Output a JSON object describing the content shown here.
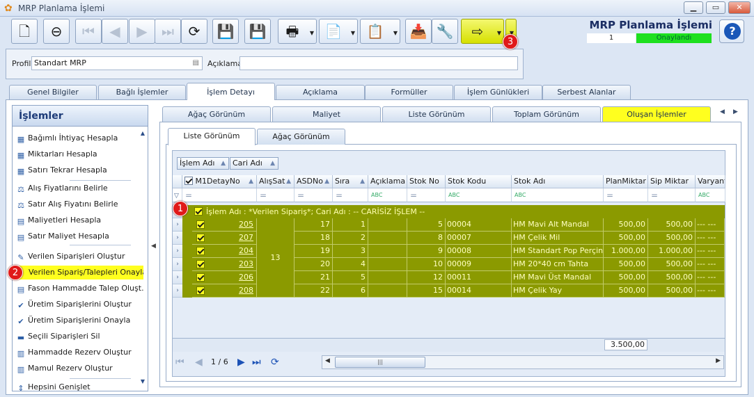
{
  "window": {
    "title": "MRP Planlama İşlemi"
  },
  "header": {
    "title": "MRP Planlama İşlemi",
    "record_no": "1",
    "status": "Onaylandı",
    "status_color": "#1ee01e"
  },
  "toolbar": [
    {
      "name": "new-button",
      "icon": "new-doc-icon",
      "glyph": "🗋",
      "disabled": false,
      "dropdown": false
    },
    {
      "name": "delete-button",
      "icon": "delete-doc-icon",
      "glyph": "⊖",
      "disabled": false,
      "dropdown": false
    },
    {
      "name": "first-record-button",
      "icon": "first-icon",
      "glyph": "⏮",
      "disabled": true,
      "dropdown": false
    },
    {
      "name": "prev-record-button",
      "icon": "prev-icon",
      "glyph": "◀",
      "disabled": true,
      "dropdown": false
    },
    {
      "name": "next-record-button",
      "icon": "next-icon",
      "glyph": "▶",
      "disabled": true,
      "dropdown": false
    },
    {
      "name": "last-record-button",
      "icon": "last-icon",
      "glyph": "⏭",
      "disabled": true,
      "dropdown": false
    },
    {
      "name": "refresh-button",
      "icon": "refresh-icon",
      "glyph": "⟳",
      "disabled": false,
      "dropdown": false
    },
    {
      "name": "save-button",
      "icon": "save-icon",
      "glyph": "💾",
      "disabled": true,
      "dropdown": false
    },
    {
      "name": "cancel-save-button",
      "icon": "save-cancel-icon",
      "glyph": "💾",
      "disabled": true,
      "dropdown": false
    },
    {
      "name": "print-button",
      "icon": "printer-icon",
      "glyph": "🖶",
      "disabled": false,
      "dropdown": true
    },
    {
      "name": "pdf-export-button",
      "icon": "pdf-icon",
      "glyph": "📄",
      "disabled": false,
      "dropdown": true
    },
    {
      "name": "export-button",
      "icon": "export-icon",
      "glyph": "📋",
      "disabled": false,
      "dropdown": true
    },
    {
      "name": "import-button",
      "icon": "import-icon",
      "glyph": "📥",
      "disabled": false,
      "dropdown": false
    },
    {
      "name": "tools-button",
      "icon": "wrench-icon",
      "glyph": "🔧",
      "disabled": false,
      "dropdown": false
    },
    {
      "name": "exit-button",
      "icon": "exit-door-icon",
      "glyph": "⇨",
      "disabled": false,
      "dropdown": true
    }
  ],
  "profile": {
    "label": "Profil",
    "value": "Standart MRP",
    "desc_label": "Açıklama",
    "desc_value": ""
  },
  "main_tabs": [
    "Genel Bilgiler",
    "Bağlı İşlemler",
    "İşlem Detayı",
    "Açıklama",
    "Formüller",
    "İşlem Günlükleri",
    "Serbest Alanlar"
  ],
  "actions": {
    "title": "İşlemler",
    "items": [
      {
        "label": "Bağımlı İhtiyaç Hesapla",
        "icon": "calc-table-icon",
        "glyph": "▦"
      },
      {
        "label": "Miktarları Hesapla",
        "icon": "calc-table-icon",
        "glyph": "▦"
      },
      {
        "label": "Satırı Tekrar Hesapla",
        "icon": "calc-table-icon",
        "glyph": "▦"
      },
      {
        "label": "Alış Fiyatlarını Belirle",
        "icon": "price-chart-icon",
        "glyph": "⚖"
      },
      {
        "label": "Satır Alış Fiyatını Belirle",
        "icon": "price-chart-icon",
        "glyph": "⚖"
      },
      {
        "label": "Maliyetleri Hesapla",
        "icon": "cost-icon",
        "glyph": "▤"
      },
      {
        "label": "Satır Maliyet Hesapla",
        "icon": "cost-icon",
        "glyph": "▤"
      },
      {
        "label": "Verilen Siparişleri Oluştur",
        "icon": "order-create-icon",
        "glyph": "✎"
      },
      {
        "label": "Verilen Sipariş/Talepleri Onayla",
        "icon": "order-approve-icon",
        "glyph": "✎"
      },
      {
        "label": "Fason Hammadde Talep Oluşt...",
        "icon": "request-icon",
        "glyph": "▤"
      },
      {
        "label": "Üretim Siparişlerini Oluştur",
        "icon": "check-icon",
        "glyph": "✔"
      },
      {
        "label": "Üretim Siparişlerini Onayla",
        "icon": "check-icon",
        "glyph": "✔"
      },
      {
        "label": "Seçili Siparişleri Sil",
        "icon": "delete-line-icon",
        "glyph": "▬"
      },
      {
        "label": "Hammadde Rezerv Oluştur",
        "icon": "reserve-icon",
        "glyph": "▥"
      },
      {
        "label": "Mamul Rezerv Oluştur",
        "icon": "reserve-icon",
        "glyph": "▥"
      },
      {
        "label": "Hepsini Genişlet",
        "icon": "expand-icon",
        "glyph": "⇕"
      }
    ]
  },
  "sub_tabs": [
    "Ağaç Görünüm",
    "Maliyet",
    "Liste Görünüm",
    "Toplam Görünüm",
    "Oluşan İşlemler"
  ],
  "third_tabs": [
    "Liste Görünüm",
    "Ağaç Görünüm"
  ],
  "grid": {
    "group_chips": [
      "İşlem Adı",
      "Cari Adı"
    ],
    "columns": [
      "M1DetayNo",
      "AlışSat",
      "ASDNo",
      "Sıra",
      "Açıklama",
      "Stok No",
      "Stok Kodu",
      "Stok Adı",
      "PlanMiktar",
      "Sip Miktar",
      "Varyant"
    ],
    "filter_marks": [
      "=",
      "=",
      "=",
      "=",
      "ABC",
      "=",
      "ABC",
      "ABC",
      "=",
      "=",
      "ABC"
    ],
    "group_row": "İşlem Adı : *Verilen Sipariş*;  Cari Adı : -- CARİSİZ İŞLEM --",
    "alis_sat": "13",
    "rows": [
      {
        "detay_no": "205",
        "asd_no": "17",
        "sira": "1",
        "aciklama": "",
        "stok_no": "5",
        "stok_kodu": "00004",
        "stok_adi": "HM Mavi Alt Mandal",
        "plan": "500,00",
        "sip": "500,00",
        "varyant": "--- ---"
      },
      {
        "detay_no": "207",
        "asd_no": "18",
        "sira": "2",
        "aciklama": "",
        "stok_no": "8",
        "stok_kodu": "00007",
        "stok_adi": "HM Çelik Mil",
        "plan": "500,00",
        "sip": "500,00",
        "varyant": "--- ---"
      },
      {
        "detay_no": "204",
        "asd_no": "19",
        "sira": "3",
        "aciklama": "",
        "stok_no": "9",
        "stok_kodu": "00008",
        "stok_adi": "HM Standart Pop Perçin",
        "plan": "1.000,00",
        "sip": "1.000,00",
        "varyant": "--- ---"
      },
      {
        "detay_no": "203",
        "asd_no": "20",
        "sira": "4",
        "aciklama": "",
        "stok_no": "10",
        "stok_kodu": "00009",
        "stok_adi": "HM 20*40 cm Tahta",
        "plan": "500,00",
        "sip": "500,00",
        "varyant": "--- ---"
      },
      {
        "detay_no": "206",
        "asd_no": "21",
        "sira": "5",
        "aciklama": "",
        "stok_no": "12",
        "stok_kodu": "00011",
        "stok_adi": "HM Mavi Üst Mandal",
        "plan": "500,00",
        "sip": "500,00",
        "varyant": "--- ---"
      },
      {
        "detay_no": "208",
        "asd_no": "22",
        "sira": "6",
        "aciklama": "",
        "stok_no": "15",
        "stok_kodu": "00014",
        "stok_adi": "HM Çelik Yay",
        "plan": "500,00",
        "sip": "500,00",
        "varyant": "--- ---"
      }
    ],
    "total_plan": "3.500,00",
    "page_info": "1 / 6"
  },
  "callouts": [
    "1",
    "2",
    "3"
  ],
  "colors": {
    "highlight": "#ffff1f",
    "grid_olive": "#8b9a00",
    "accent": "#1d3b78"
  }
}
